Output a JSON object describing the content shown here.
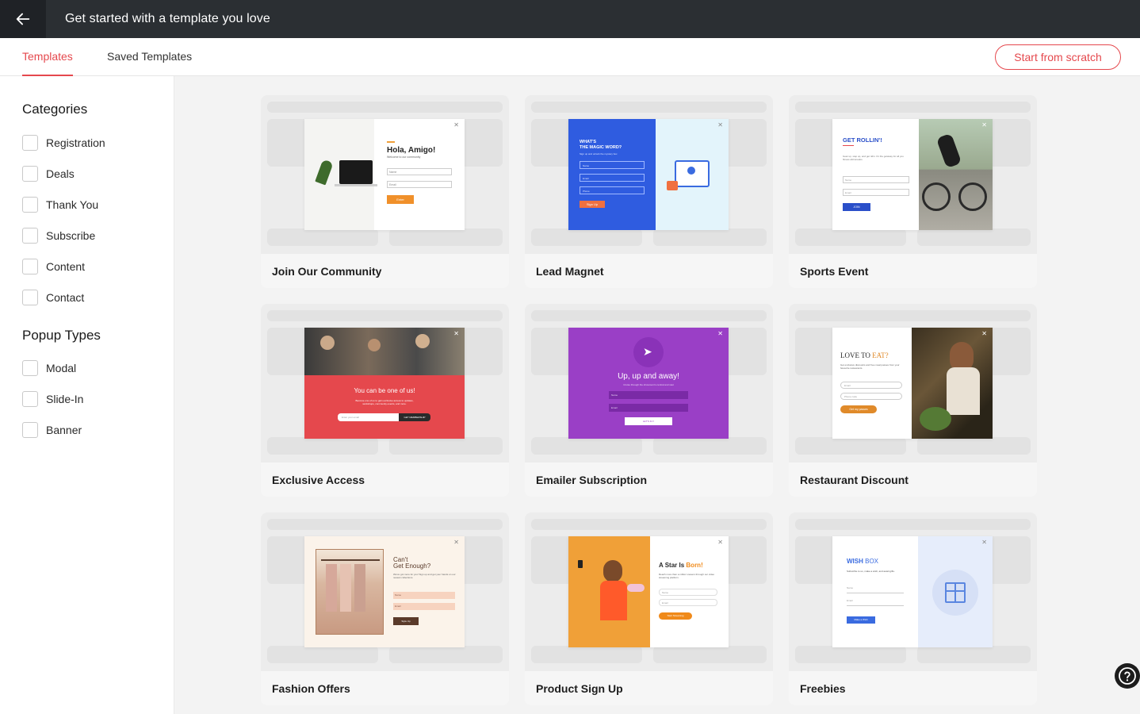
{
  "header": {
    "title": "Get started with a template you love",
    "back_icon": "arrow-left-icon"
  },
  "tabs": [
    {
      "label": "Templates",
      "active": true
    },
    {
      "label": "Saved Templates",
      "active": false
    }
  ],
  "start_button": "Start from scratch",
  "sidebar": {
    "categories_title": "Categories",
    "categories": [
      "Registration",
      "Deals",
      "Thank You",
      "Subscribe",
      "Content",
      "Contact"
    ],
    "popup_types_title": "Popup Types",
    "popup_types": [
      "Modal",
      "Slide-In",
      "Banner"
    ]
  },
  "templates": [
    {
      "name": "Join Our Community",
      "preview": {
        "heading": "Hola, Amigo!",
        "sub": "Welcome to our community",
        "field1": "Name",
        "field2": "Email",
        "button": "Enter"
      }
    },
    {
      "name": "Lead Magnet",
      "preview": {
        "heading": "WHAT'S\nTHE MAGIC WORD?",
        "sub": "Sign up and unlock the mystery box",
        "field1": "Name",
        "field2": "Email",
        "field3": "Phone",
        "button": "Sign Up"
      }
    },
    {
      "name": "Sports Event",
      "preview": {
        "heading": "GET ROLLIN'!",
        "sub": "Gear up, step up, and get ridin. It's the getaway for all you fitness aficionados.",
        "field1": "Name",
        "field2": "Email",
        "button": "JOIN"
      }
    },
    {
      "name": "Exclusive Access",
      "preview": {
        "heading": "You can be one of us!",
        "sub": "Become one of us to gain exclusive access to updates, workshops, community events, and more.",
        "field1": "Enter your email",
        "button": "GET MEMBERSHIP"
      }
    },
    {
      "name": "Emailer Subscription",
      "preview": {
        "heading": "Up, up and away!",
        "sub": "Cruise through the showroom's central and vast",
        "field1": "Name",
        "field2": "Email",
        "button": "LET'S FLY"
      }
    },
    {
      "name": "Restaurant Discount",
      "preview": {
        "heading": "LOVE TO",
        "heading_accent": "EAT?",
        "sub": "Get exclusive discounts and free meal passes from your favourite restaurants.",
        "field1": "Email",
        "field2": "Phone code",
        "button": "Get my passes"
      }
    },
    {
      "name": "Fashion Offers",
      "preview": {
        "heading": "Can't\nGet Enough?",
        "sub": "We've got more for you! Sign up and get your hands on our newest collections.",
        "field1": "Name",
        "field2": "Email",
        "button": "Style Up"
      }
    },
    {
      "name": "Product Sign Up",
      "preview": {
        "heading": "A Star Is",
        "heading_accent": "Born!",
        "sub": "Reach more than a million viewers through our video streaming platform.",
        "field1": "Name",
        "field2": "Email",
        "button": "Start Streaming"
      }
    },
    {
      "name": "Freebies",
      "preview": {
        "heading": "WISH",
        "heading_accent": "BOX",
        "sub": "Subscribe to us, make a wish, and await gifts.",
        "field1": "Name",
        "field2": "Email",
        "button": "Make a Wish"
      }
    }
  ],
  "colors": {
    "accent": "#e5484d",
    "header_bg": "#2b2f33"
  },
  "help_icon": "question-circle-icon"
}
